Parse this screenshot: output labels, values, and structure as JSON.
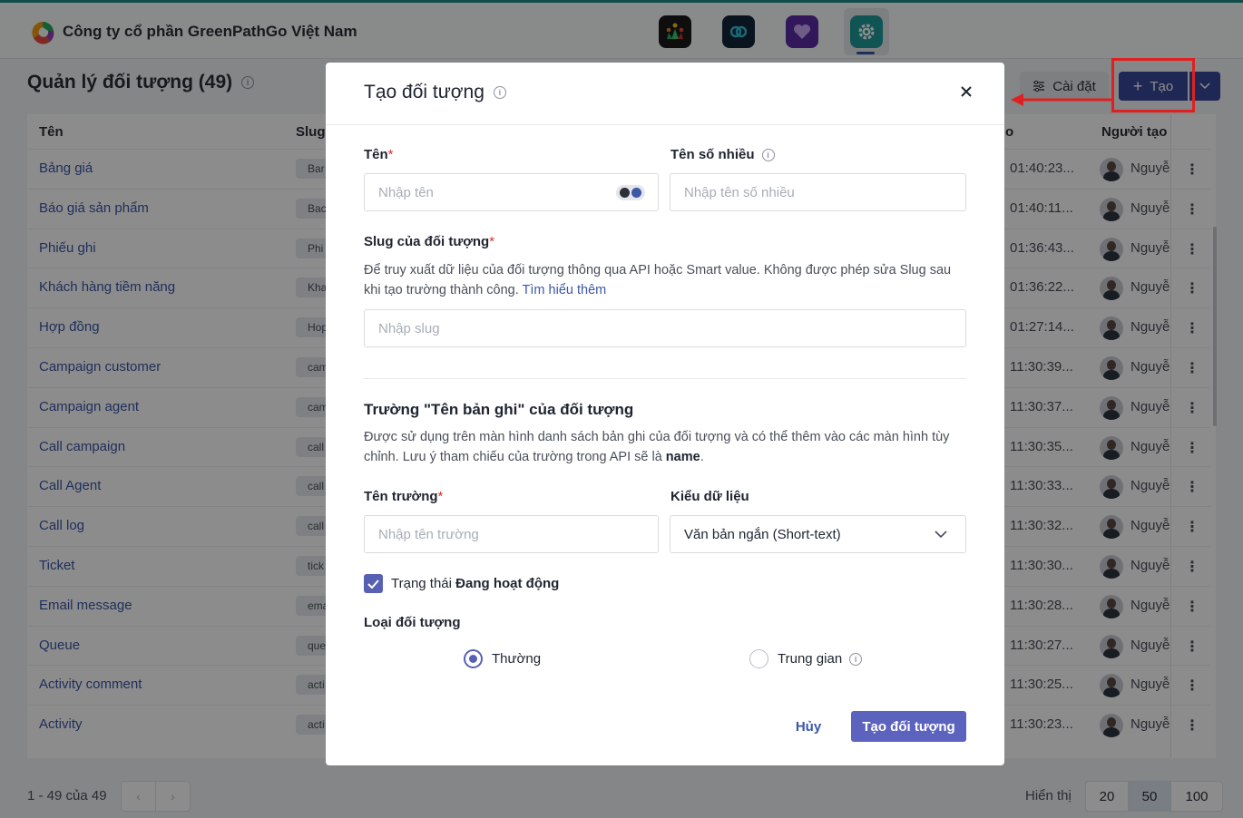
{
  "app": {
    "company": "Công ty cổ phần GreenPathGo Việt Nam"
  },
  "header": {
    "apps": [
      "team-app-icon",
      "link-app-icon",
      "heart-app-icon",
      "settings-app-icon"
    ],
    "active_app": "settings-app-icon"
  },
  "page": {
    "title": "Quản lý đối tượng (49)",
    "settings_label": "Cài đặt",
    "create_label": "Tạo"
  },
  "table": {
    "columns": {
      "name": "Tên",
      "slug": "Slug",
      "updated": "o",
      "creator": "Người tạo"
    },
    "rows": [
      {
        "name": "Bảng giá",
        "slug": "Bar",
        "time": "01:40:23...",
        "creator": "Nguyễ"
      },
      {
        "name": "Báo giá sản phẩm",
        "slug": "Bac",
        "time": "01:40:11...",
        "creator": "Nguyễ"
      },
      {
        "name": "Phiếu ghi",
        "slug": "Phi",
        "time": "01:36:43...",
        "creator": "Nguyễ"
      },
      {
        "name": "Khách hàng tiềm năng",
        "slug": "Kha",
        "time": "01:36:22...",
        "creator": "Nguyễ"
      },
      {
        "name": "Hợp đồng",
        "slug": "Hop",
        "time": "01:27:14...",
        "creator": "Nguyễ"
      },
      {
        "name": "Campaign customer",
        "slug": "cam",
        "time": "11:30:39...",
        "creator": "Nguyễ"
      },
      {
        "name": "Campaign agent",
        "slug": "cam",
        "time": "11:30:37...",
        "creator": "Nguyễ"
      },
      {
        "name": "Call campaign",
        "slug": "call",
        "time": "11:30:35...",
        "creator": "Nguyễ"
      },
      {
        "name": "Call Agent",
        "slug": "call",
        "time": "11:30:33...",
        "creator": "Nguyễ"
      },
      {
        "name": "Call log",
        "slug": "call",
        "time": "11:30:32...",
        "creator": "Nguyễ"
      },
      {
        "name": "Ticket",
        "slug": "tick",
        "time": "11:30:30...",
        "creator": "Nguyễ"
      },
      {
        "name": "Email message",
        "slug": "ema",
        "time": "11:30:28...",
        "creator": "Nguyễ"
      },
      {
        "name": "Queue",
        "slug": "que",
        "time": "11:30:27...",
        "creator": "Nguyễ"
      },
      {
        "name": "Activity comment",
        "slug": "acti",
        "time": "11:30:25...",
        "creator": "Nguyễ"
      },
      {
        "name": "Activity",
        "slug": "acti",
        "time": "11:30:23...",
        "creator": "Nguyễ"
      }
    ]
  },
  "footer": {
    "range": "1 - 49 của 49",
    "show_label": "Hiển thị",
    "page_sizes": [
      "20",
      "50",
      "100"
    ],
    "selected_page_size": "50"
  },
  "modal": {
    "title": "Tạo đối tượng",
    "name_label": "Tên",
    "name_placeholder": "Nhập tên",
    "plural_label": "Tên số nhiều",
    "plural_placeholder": "Nhập tên số nhiều",
    "slug_label": "Slug của đối tượng",
    "slug_desc": "Để truy xuất dữ liệu của đối tượng thông qua API hoặc Smart value. Không được phép sửa Slug sau khi tạo trường thành công.",
    "slug_link": "Tìm hiểu thêm",
    "slug_placeholder": "Nhập slug",
    "record_section_title": "Trường \"Tên bản ghi\" của đối tượng",
    "record_desc": "Được sử dụng trên màn hình danh sách bản ghi của đối tượng và có thể thêm vào các màn hình tùy chỉnh. Lưu ý tham chiếu của trường trong API sẽ là",
    "record_desc_key": "name",
    "record_desc_end": ".",
    "field_name_label": "Tên trường",
    "field_name_placeholder": "Nhập tên trường",
    "data_type_label": "Kiểu dữ liệu",
    "data_type_value": "Văn bản ngắn (Short-text)",
    "status_prefix": "Trạng thái",
    "status_value": "Đang hoạt động",
    "status_checked": true,
    "type_label": "Loại đối tượng",
    "type_options": [
      "Thường",
      "Trung gian"
    ],
    "type_selected": "Thường",
    "cancel_label": "Hủy",
    "submit_label": "Tạo đối tượng"
  },
  "colors": {
    "primary": "#5c63bf",
    "create_button": "#3a4a9a",
    "link": "#3a57a8",
    "required": "#d93030",
    "highlight": "#e02020",
    "top_accent": "#1e8c8a"
  }
}
